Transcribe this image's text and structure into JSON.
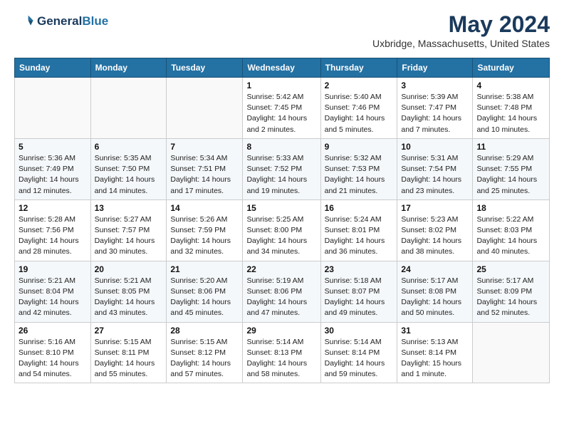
{
  "header": {
    "logo_line1": "General",
    "logo_line2": "Blue",
    "month": "May 2024",
    "location": "Uxbridge, Massachusetts, United States"
  },
  "weekdays": [
    "Sunday",
    "Monday",
    "Tuesday",
    "Wednesday",
    "Thursday",
    "Friday",
    "Saturday"
  ],
  "weeks": [
    [
      {
        "day": "",
        "sunrise": "",
        "sunset": "",
        "daylight": ""
      },
      {
        "day": "",
        "sunrise": "",
        "sunset": "",
        "daylight": ""
      },
      {
        "day": "",
        "sunrise": "",
        "sunset": "",
        "daylight": ""
      },
      {
        "day": "1",
        "sunrise": "Sunrise: 5:42 AM",
        "sunset": "Sunset: 7:45 PM",
        "daylight": "Daylight: 14 hours and 2 minutes."
      },
      {
        "day": "2",
        "sunrise": "Sunrise: 5:40 AM",
        "sunset": "Sunset: 7:46 PM",
        "daylight": "Daylight: 14 hours and 5 minutes."
      },
      {
        "day": "3",
        "sunrise": "Sunrise: 5:39 AM",
        "sunset": "Sunset: 7:47 PM",
        "daylight": "Daylight: 14 hours and 7 minutes."
      },
      {
        "day": "4",
        "sunrise": "Sunrise: 5:38 AM",
        "sunset": "Sunset: 7:48 PM",
        "daylight": "Daylight: 14 hours and 10 minutes."
      }
    ],
    [
      {
        "day": "5",
        "sunrise": "Sunrise: 5:36 AM",
        "sunset": "Sunset: 7:49 PM",
        "daylight": "Daylight: 14 hours and 12 minutes."
      },
      {
        "day": "6",
        "sunrise": "Sunrise: 5:35 AM",
        "sunset": "Sunset: 7:50 PM",
        "daylight": "Daylight: 14 hours and 14 minutes."
      },
      {
        "day": "7",
        "sunrise": "Sunrise: 5:34 AM",
        "sunset": "Sunset: 7:51 PM",
        "daylight": "Daylight: 14 hours and 17 minutes."
      },
      {
        "day": "8",
        "sunrise": "Sunrise: 5:33 AM",
        "sunset": "Sunset: 7:52 PM",
        "daylight": "Daylight: 14 hours and 19 minutes."
      },
      {
        "day": "9",
        "sunrise": "Sunrise: 5:32 AM",
        "sunset": "Sunset: 7:53 PM",
        "daylight": "Daylight: 14 hours and 21 minutes."
      },
      {
        "day": "10",
        "sunrise": "Sunrise: 5:31 AM",
        "sunset": "Sunset: 7:54 PM",
        "daylight": "Daylight: 14 hours and 23 minutes."
      },
      {
        "day": "11",
        "sunrise": "Sunrise: 5:29 AM",
        "sunset": "Sunset: 7:55 PM",
        "daylight": "Daylight: 14 hours and 25 minutes."
      }
    ],
    [
      {
        "day": "12",
        "sunrise": "Sunrise: 5:28 AM",
        "sunset": "Sunset: 7:56 PM",
        "daylight": "Daylight: 14 hours and 28 minutes."
      },
      {
        "day": "13",
        "sunrise": "Sunrise: 5:27 AM",
        "sunset": "Sunset: 7:57 PM",
        "daylight": "Daylight: 14 hours and 30 minutes."
      },
      {
        "day": "14",
        "sunrise": "Sunrise: 5:26 AM",
        "sunset": "Sunset: 7:59 PM",
        "daylight": "Daylight: 14 hours and 32 minutes."
      },
      {
        "day": "15",
        "sunrise": "Sunrise: 5:25 AM",
        "sunset": "Sunset: 8:00 PM",
        "daylight": "Daylight: 14 hours and 34 minutes."
      },
      {
        "day": "16",
        "sunrise": "Sunrise: 5:24 AM",
        "sunset": "Sunset: 8:01 PM",
        "daylight": "Daylight: 14 hours and 36 minutes."
      },
      {
        "day": "17",
        "sunrise": "Sunrise: 5:23 AM",
        "sunset": "Sunset: 8:02 PM",
        "daylight": "Daylight: 14 hours and 38 minutes."
      },
      {
        "day": "18",
        "sunrise": "Sunrise: 5:22 AM",
        "sunset": "Sunset: 8:03 PM",
        "daylight": "Daylight: 14 hours and 40 minutes."
      }
    ],
    [
      {
        "day": "19",
        "sunrise": "Sunrise: 5:21 AM",
        "sunset": "Sunset: 8:04 PM",
        "daylight": "Daylight: 14 hours and 42 minutes."
      },
      {
        "day": "20",
        "sunrise": "Sunrise: 5:21 AM",
        "sunset": "Sunset: 8:05 PM",
        "daylight": "Daylight: 14 hours and 43 minutes."
      },
      {
        "day": "21",
        "sunrise": "Sunrise: 5:20 AM",
        "sunset": "Sunset: 8:06 PM",
        "daylight": "Daylight: 14 hours and 45 minutes."
      },
      {
        "day": "22",
        "sunrise": "Sunrise: 5:19 AM",
        "sunset": "Sunset: 8:06 PM",
        "daylight": "Daylight: 14 hours and 47 minutes."
      },
      {
        "day": "23",
        "sunrise": "Sunrise: 5:18 AM",
        "sunset": "Sunset: 8:07 PM",
        "daylight": "Daylight: 14 hours and 49 minutes."
      },
      {
        "day": "24",
        "sunrise": "Sunrise: 5:17 AM",
        "sunset": "Sunset: 8:08 PM",
        "daylight": "Daylight: 14 hours and 50 minutes."
      },
      {
        "day": "25",
        "sunrise": "Sunrise: 5:17 AM",
        "sunset": "Sunset: 8:09 PM",
        "daylight": "Daylight: 14 hours and 52 minutes."
      }
    ],
    [
      {
        "day": "26",
        "sunrise": "Sunrise: 5:16 AM",
        "sunset": "Sunset: 8:10 PM",
        "daylight": "Daylight: 14 hours and 54 minutes."
      },
      {
        "day": "27",
        "sunrise": "Sunrise: 5:15 AM",
        "sunset": "Sunset: 8:11 PM",
        "daylight": "Daylight: 14 hours and 55 minutes."
      },
      {
        "day": "28",
        "sunrise": "Sunrise: 5:15 AM",
        "sunset": "Sunset: 8:12 PM",
        "daylight": "Daylight: 14 hours and 57 minutes."
      },
      {
        "day": "29",
        "sunrise": "Sunrise: 5:14 AM",
        "sunset": "Sunset: 8:13 PM",
        "daylight": "Daylight: 14 hours and 58 minutes."
      },
      {
        "day": "30",
        "sunrise": "Sunrise: 5:14 AM",
        "sunset": "Sunset: 8:14 PM",
        "daylight": "Daylight: 14 hours and 59 minutes."
      },
      {
        "day": "31",
        "sunrise": "Sunrise: 5:13 AM",
        "sunset": "Sunset: 8:14 PM",
        "daylight": "Daylight: 15 hours and 1 minute."
      },
      {
        "day": "",
        "sunrise": "",
        "sunset": "",
        "daylight": ""
      }
    ]
  ]
}
